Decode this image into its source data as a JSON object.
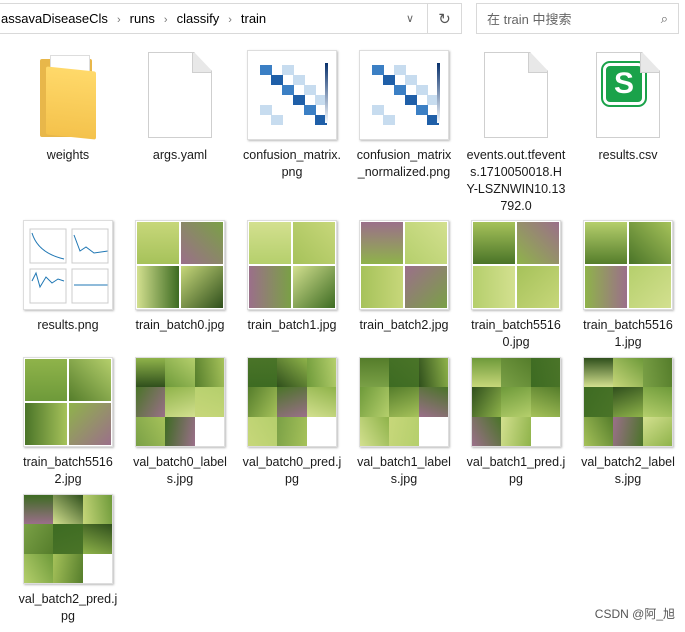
{
  "address": {
    "crumbs": [
      "assavaDiseaseCls",
      "runs",
      "classify",
      "train"
    ]
  },
  "search": {
    "placeholder": "在 train 中搜索"
  },
  "items": [
    {
      "name": "weights",
      "type": "folder"
    },
    {
      "name": "args.yaml",
      "type": "file"
    },
    {
      "name": "confusion_matrix.png",
      "type": "confusion"
    },
    {
      "name": "confusion_matrix_normalized.png",
      "type": "confusion"
    },
    {
      "name": "events.out.tfevents.1710050018.HY-LSZNWIN10.13792.0",
      "type": "file"
    },
    {
      "name": "results.csv",
      "type": "csv"
    },
    {
      "name": "results.png",
      "type": "results"
    },
    {
      "name": "train_batch0.jpg",
      "type": "train"
    },
    {
      "name": "train_batch1.jpg",
      "type": "train"
    },
    {
      "name": "train_batch2.jpg",
      "type": "train"
    },
    {
      "name": "train_batch55160.jpg",
      "type": "train"
    },
    {
      "name": "train_batch55161.jpg",
      "type": "train"
    },
    {
      "name": "train_batch55162.jpg",
      "type": "train"
    },
    {
      "name": "val_batch0_labels.jpg",
      "type": "val"
    },
    {
      "name": "val_batch0_pred.jpg",
      "type": "val"
    },
    {
      "name": "val_batch1_labels.jpg",
      "type": "val"
    },
    {
      "name": "val_batch1_pred.jpg",
      "type": "val"
    },
    {
      "name": "val_batch2_labels.jpg",
      "type": "val"
    },
    {
      "name": "val_batch2_pred.jpg",
      "type": "val"
    }
  ],
  "csv_icon_letter": "S",
  "watermark": "CSDN @阿_旭"
}
